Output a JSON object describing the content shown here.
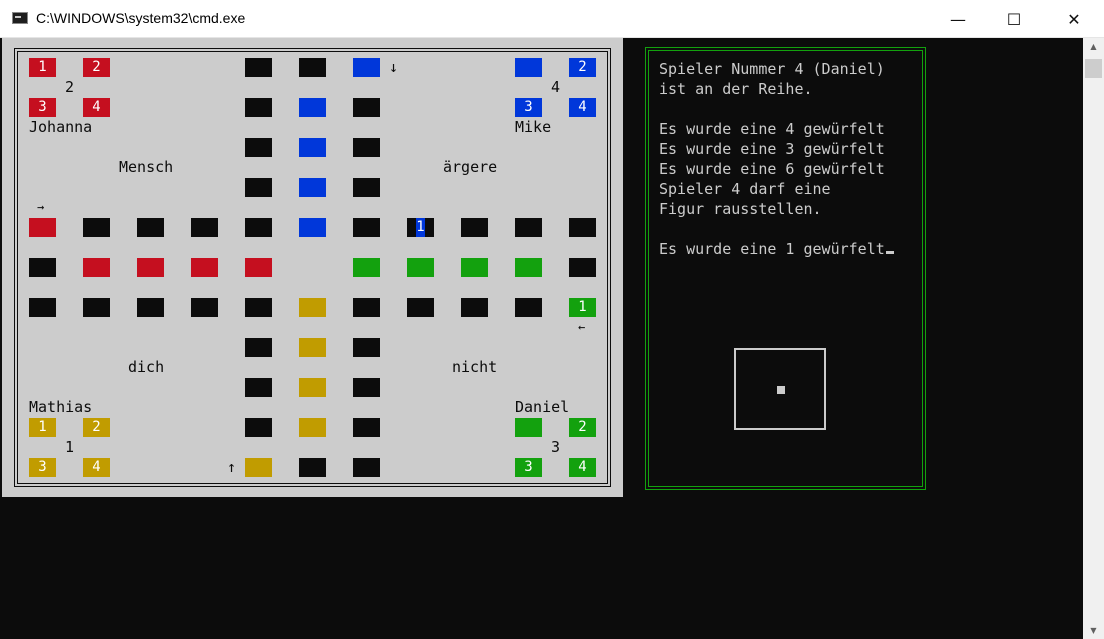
{
  "window": {
    "title": "C:\\WINDOWS\\system32\\cmd.exe",
    "icon": "cmd-icon",
    "minimize": "—",
    "maximize": "☐",
    "close": "✕"
  },
  "colors": {
    "red": "#c50f1f",
    "blue": "#0037da",
    "green": "#13a10e",
    "yellow": "#c19c00",
    "black": "#0c0c0c",
    "board": "#cccccc",
    "text": "#cccccc"
  },
  "board": {
    "title_words": [
      "Mensch",
      "ärgere",
      "dich",
      "nicht"
    ],
    "players": [
      {
        "name": "Johanna",
        "number": "2",
        "color": "red",
        "home": [
          "1",
          "2",
          "3",
          "4"
        ]
      },
      {
        "name": "Mike",
        "number": "4",
        "color": "blue",
        "home": [
          "2",
          "3",
          "4"
        ]
      },
      {
        "name": "Mathias",
        "number": "1",
        "color": "yellow",
        "home": [
          "1",
          "2",
          "3",
          "4"
        ]
      },
      {
        "name": "Daniel",
        "number": "3",
        "color": "green",
        "home": [
          "2",
          "3",
          "4"
        ]
      }
    ],
    "pieces_on_track": [
      {
        "label": "1",
        "color": "blue"
      },
      {
        "label": "1",
        "color": "green"
      }
    ],
    "start_arrows": [
      "↓",
      "→",
      "←",
      "↑"
    ]
  },
  "info": {
    "lines": [
      "Spieler Nummer 4 (Daniel)",
      "ist an der Reihe.",
      "",
      "Es wurde eine 4 gewürfelt",
      "Es wurde eine 3 gewürfelt",
      "Es wurde eine 6 gewürfelt",
      "Spieler 4 darf eine",
      "Figur rausstellen.",
      "",
      "Es wurde eine 1 gewürfelt"
    ],
    "dice_value": 1
  }
}
